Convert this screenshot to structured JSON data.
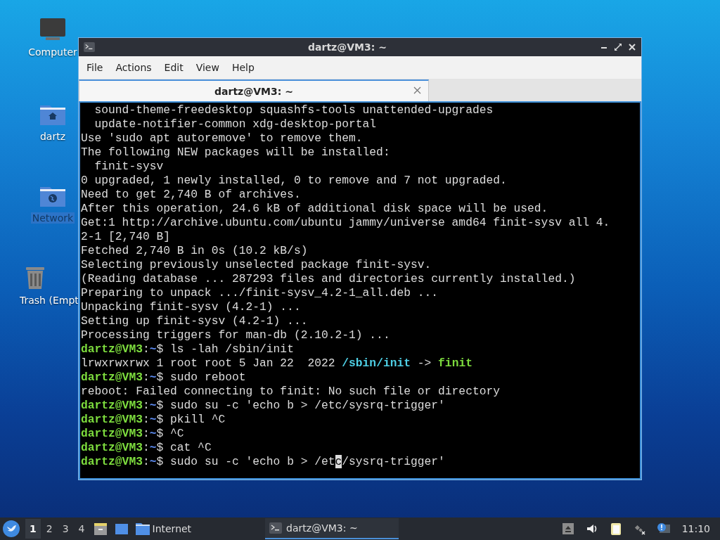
{
  "desktop_icons": [
    {
      "label": "Computer",
      "kind": "computer",
      "selected": false
    },
    {
      "label": "dartz",
      "kind": "home",
      "selected": false
    },
    {
      "label": "Network",
      "kind": "network",
      "selected": true
    },
    {
      "label": "Trash (Empt",
      "kind": "trash",
      "selected": false
    }
  ],
  "window": {
    "title": "dartz@VM3: ~",
    "menu": [
      "File",
      "Actions",
      "Edit",
      "View",
      "Help"
    ],
    "tabs": [
      {
        "label": "dartz@VM3: ~",
        "selected": true
      }
    ],
    "terminal_lines": [
      {
        "segments": [
          {
            "text": "  sound-theme-freedesktop squashfs-tools unattended-upgrades",
            "kind": "plain"
          }
        ]
      },
      {
        "segments": [
          {
            "text": "  update-notifier-common xdg-desktop-portal",
            "kind": "plain"
          }
        ]
      },
      {
        "segments": [
          {
            "text": "Use 'sudo apt autoremove' to remove them.",
            "kind": "plain"
          }
        ]
      },
      {
        "segments": [
          {
            "text": "The following NEW packages will be installed:",
            "kind": "plain"
          }
        ]
      },
      {
        "segments": [
          {
            "text": "  finit-sysv",
            "kind": "plain"
          }
        ]
      },
      {
        "segments": [
          {
            "text": "0 upgraded, 1 newly installed, 0 to remove and 7 not upgraded.",
            "kind": "plain"
          }
        ]
      },
      {
        "segments": [
          {
            "text": "Need to get 2,740 B of archives.",
            "kind": "plain"
          }
        ]
      },
      {
        "segments": [
          {
            "text": "After this operation, 24.6 kB of additional disk space will be used.",
            "kind": "plain"
          }
        ]
      },
      {
        "segments": [
          {
            "text": "Get:1 http://archive.ubuntu.com/ubuntu jammy/universe amd64 finit-sysv all 4.",
            "kind": "plain"
          }
        ]
      },
      {
        "segments": [
          {
            "text": "2-1 [2,740 B]",
            "kind": "plain"
          }
        ]
      },
      {
        "segments": [
          {
            "text": "Fetched 2,740 B in 0s (10.2 kB/s)",
            "kind": "plain"
          }
        ]
      },
      {
        "segments": [
          {
            "text": "Selecting previously unselected package finit-sysv.",
            "kind": "plain"
          }
        ]
      },
      {
        "segments": [
          {
            "text": "(Reading database ... 287293 files and directories currently installed.)",
            "kind": "plain"
          }
        ]
      },
      {
        "segments": [
          {
            "text": "Preparing to unpack .../finit-sysv_4.2-1_all.deb ...",
            "kind": "plain"
          }
        ]
      },
      {
        "segments": [
          {
            "text": "Unpacking finit-sysv (4.2-1) ...",
            "kind": "plain"
          }
        ]
      },
      {
        "segments": [
          {
            "text": "Setting up finit-sysv (4.2-1) ...",
            "kind": "plain"
          }
        ]
      },
      {
        "segments": [
          {
            "text": "Processing triggers for man-db (2.10.2-1) ...",
            "kind": "plain"
          }
        ]
      },
      {
        "segments": [
          {
            "text": "dartz@VM3",
            "kind": "user"
          },
          {
            "text": ":",
            "kind": "plain"
          },
          {
            "text": "~",
            "kind": "path"
          },
          {
            "text": "$ ls -lah /sbin/init",
            "kind": "plain"
          }
        ]
      },
      {
        "segments": [
          {
            "text": "lrwxrwxrwx 1 root root 5 Jan 22  2022 ",
            "kind": "plain"
          },
          {
            "text": "/sbin/init",
            "kind": "link"
          },
          {
            "text": " -> ",
            "kind": "plain"
          },
          {
            "text": "finit",
            "kind": "exec"
          }
        ]
      },
      {
        "segments": [
          {
            "text": "dartz@VM3",
            "kind": "user"
          },
          {
            "text": ":",
            "kind": "plain"
          },
          {
            "text": "~",
            "kind": "path"
          },
          {
            "text": "$ sudo reboot",
            "kind": "plain"
          }
        ]
      },
      {
        "segments": [
          {
            "text": "reboot: Failed connecting to finit: No such file or directory",
            "kind": "plain"
          }
        ]
      },
      {
        "segments": [
          {
            "text": "dartz@VM3",
            "kind": "user"
          },
          {
            "text": ":",
            "kind": "plain"
          },
          {
            "text": "~",
            "kind": "path"
          },
          {
            "text": "$ sudo su -c 'echo b > /etc/sysrq-trigger'",
            "kind": "plain"
          }
        ]
      },
      {
        "segments": [
          {
            "text": "dartz@VM3",
            "kind": "user"
          },
          {
            "text": ":",
            "kind": "plain"
          },
          {
            "text": "~",
            "kind": "path"
          },
          {
            "text": "$ pkill ^C",
            "kind": "plain"
          }
        ]
      },
      {
        "segments": [
          {
            "text": "dartz@VM3",
            "kind": "user"
          },
          {
            "text": ":",
            "kind": "plain"
          },
          {
            "text": "~",
            "kind": "path"
          },
          {
            "text": "$ ^C",
            "kind": "plain"
          }
        ]
      },
      {
        "segments": [
          {
            "text": "dartz@VM3",
            "kind": "user"
          },
          {
            "text": ":",
            "kind": "plain"
          },
          {
            "text": "~",
            "kind": "path"
          },
          {
            "text": "$ cat ^C",
            "kind": "plain"
          }
        ]
      },
      {
        "segments": [
          {
            "text": "dartz@VM3",
            "kind": "user"
          },
          {
            "text": ":",
            "kind": "plain"
          },
          {
            "text": "~",
            "kind": "path"
          },
          {
            "text": "$ sudo su -c 'echo b > /et",
            "kind": "plain"
          },
          {
            "text": "c",
            "kind": "cursor"
          },
          {
            "text": "/sysrq-trigger'",
            "kind": "plain"
          }
        ]
      }
    ]
  },
  "taskbar": {
    "workspaces": [
      {
        "label": "1",
        "selected": true
      },
      {
        "label": "2",
        "selected": false
      },
      {
        "label": "3",
        "selected": false
      },
      {
        "label": "4",
        "selected": false
      }
    ],
    "launchers": [
      {
        "kind": "files"
      },
      {
        "kind": "desktop"
      },
      {
        "kind": "folder",
        "label": "Internet"
      }
    ],
    "tasks": [
      {
        "label": "dartz@VM3: ~",
        "selected": true
      }
    ],
    "clock": "11:10"
  }
}
